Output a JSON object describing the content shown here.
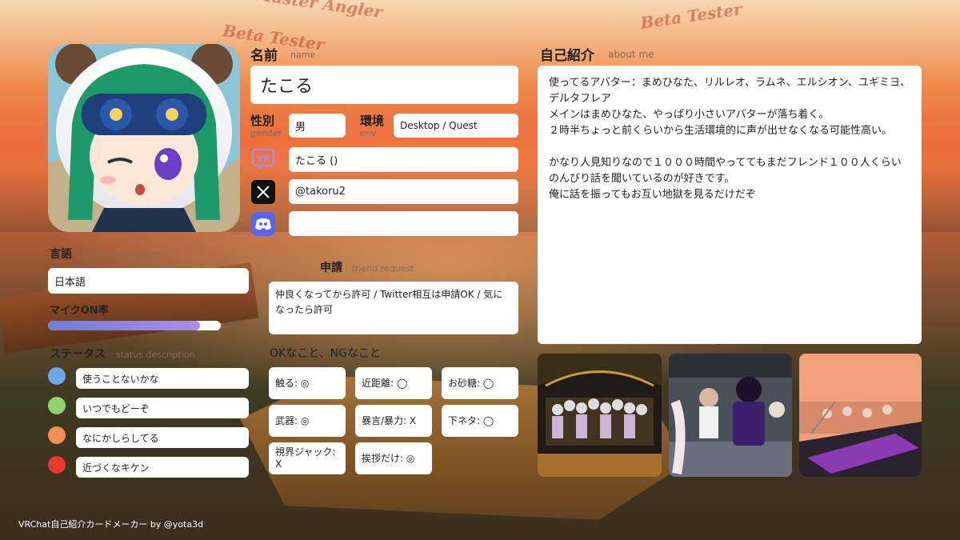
{
  "background_badges": [
    "Master Angler",
    "Beta Tester",
    "Beta Tester"
  ],
  "name": {
    "label_ja": "名前",
    "label_en": "name",
    "value": "たこる"
  },
  "gender": {
    "label_ja": "性別",
    "label_en": "gender",
    "value": "男"
  },
  "env": {
    "label_ja": "環境",
    "label_en": "env",
    "value": "Desktop / Quest"
  },
  "social": {
    "vrchat_icon": "vrchat-icon",
    "vrchat_label": "VR",
    "vrchat_value": "たこる ()",
    "x_icon": "x-icon",
    "x_value": "@takoru2",
    "discord_icon": "discord-icon",
    "discord_value": ""
  },
  "friend_request": {
    "label_ja": "申請",
    "label_en": "friend request",
    "value": "仲良くなってから許可 / Twitter相互は申請OK / 気になったら許可"
  },
  "languages": {
    "label_ja": "言語",
    "label_en": "languages spoken",
    "value": "日本語"
  },
  "mic": {
    "label_ja": "マイクON率",
    "percent_text": "88%",
    "value_fraction": 0.88
  },
  "status": {
    "label_ja": "ステータス",
    "label_en": "status description",
    "items": [
      {
        "color": "#6aa8e8",
        "text": "使うことないかな"
      },
      {
        "color": "#8ed36a",
        "text": "いつでもどーぞ"
      },
      {
        "color": "#ef8f55",
        "text": "なにかしらしてる"
      },
      {
        "color": "#e63a2e",
        "text": "近づくなキケン"
      }
    ]
  },
  "ok_ng": {
    "label": "OKなこと、NGなこと",
    "items": [
      "触る: ◎",
      "近距離: ◯",
      "お砂糖: ◯",
      "武器: ◎",
      "暴言/暴力: X",
      "下ネタ: ◯",
      "視界ジャック: X",
      "挨拶だけ: ◎"
    ]
  },
  "about": {
    "label_ja": "自己紹介",
    "label_en": "about me",
    "paragraphs": [
      "使ってるアバター：まめひなた、リルレオ、ラムネ、エルシオン、ユギミヨ、デルタフレア",
      "メインはまめひなた、やっぱり小さいアバターが落ち着く。",
      "２時半ちょっと前くらいから生活環境的に声が出せなくなる可能性高い。",
      "",
      "かなり人見知りなので１０００時間やっててもまだフレンド１００人くらい",
      "のんびり話を聞いているのが好きです。",
      "俺に話を振ってもお互い地獄を見るだけだぞ"
    ]
  },
  "credit": "VRChat自己紹介カードメーカー by @yota3d"
}
